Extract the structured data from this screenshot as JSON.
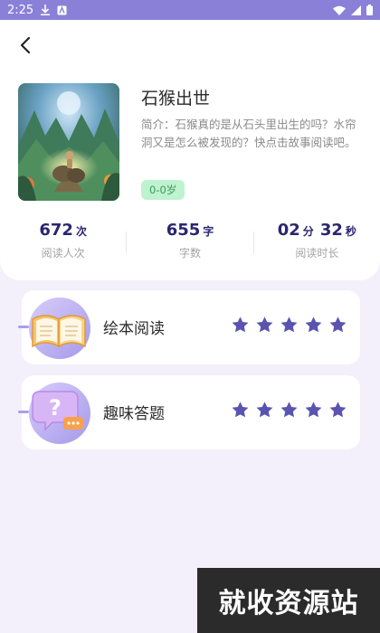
{
  "status_bar": {
    "time": "2:25"
  },
  "book": {
    "title": "石猴出世",
    "intro": "简介：石猴真的是从石头里出生的吗？水帘洞又是怎么被发现的？快点击故事阅读吧。",
    "age": "0-0岁"
  },
  "stats": [
    {
      "value": "672",
      "unit": "次",
      "label": "阅读人次"
    },
    {
      "value": "655",
      "unit": "字",
      "label": "字数"
    },
    {
      "value_min": "02",
      "unit_min": "分",
      "value_sec": "32",
      "unit_sec": "秒",
      "label": "阅读时长"
    }
  ],
  "activities": [
    {
      "label": "绘本阅读",
      "icon": "open-book-icon",
      "stars": 5
    },
    {
      "label": "趣味答题",
      "icon": "question-chat-icon",
      "stars": 5
    }
  ],
  "watermark": "就收资源站",
  "colors": {
    "status_bar": "#8b80d8",
    "accent": "#5a54b0",
    "badge_bg": "#bff2cf",
    "badge_text": "#3a9a5c",
    "page_bg": "#f3f0fb"
  }
}
